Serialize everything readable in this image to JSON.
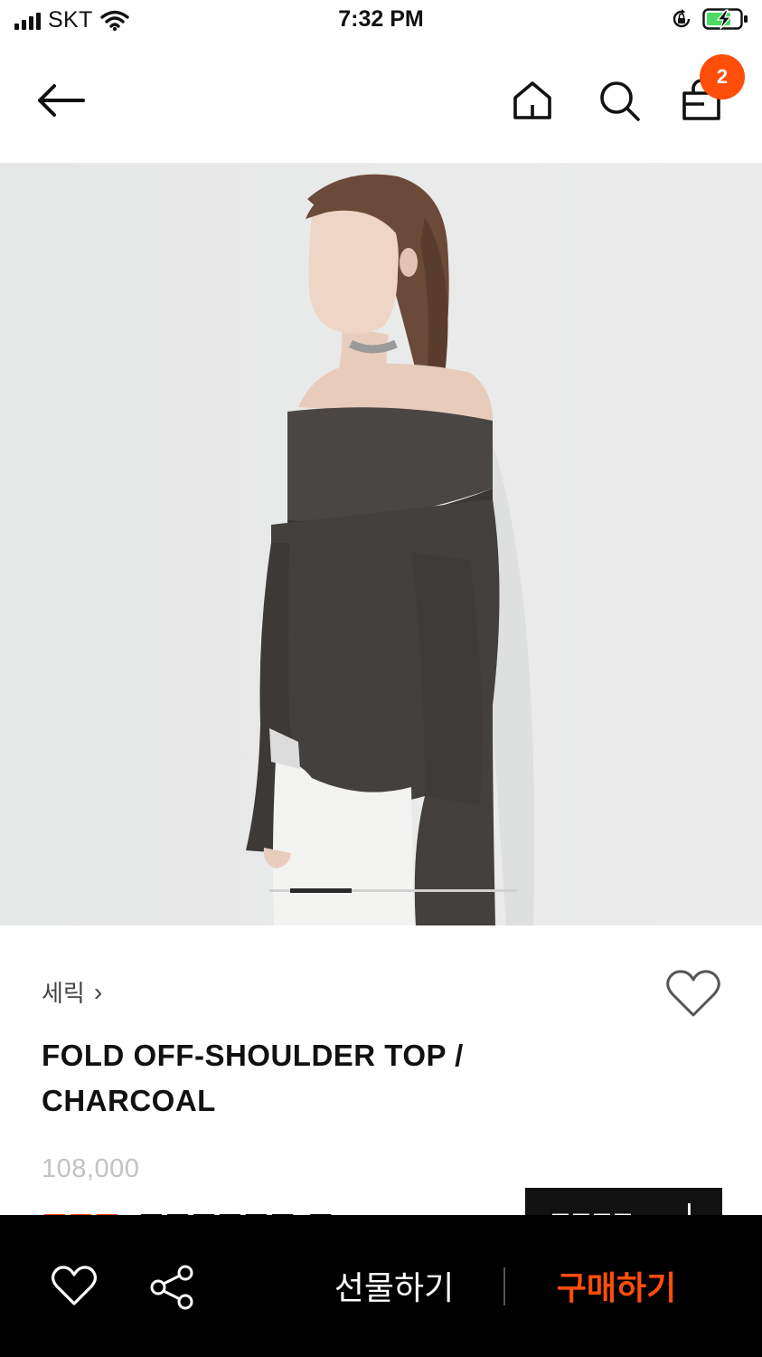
{
  "status_bar": {
    "carrier": "SKT",
    "time": "7:32 PM"
  },
  "nav": {
    "cart_count": "2",
    "accent_color": "#ff4d0a"
  },
  "product": {
    "brand": "세릭",
    "brand_chevron": "›",
    "title_line1": "FOLD OFF-SHOULDER TOP /",
    "title_line2": "CHARCOAL",
    "original_price": "108,000"
  },
  "gallery": {
    "image_description_icon": "model-wearing-charcoal-off-shoulder-top",
    "active_page_fraction": 0.25
  },
  "bottom_bar": {
    "gift_label": "선물하기",
    "buy_label": "구매하기"
  },
  "colors": {
    "accent": "#ff4d0a",
    "bottom_bar_bg": "#000000",
    "hero_bg": "#e9eaea"
  }
}
